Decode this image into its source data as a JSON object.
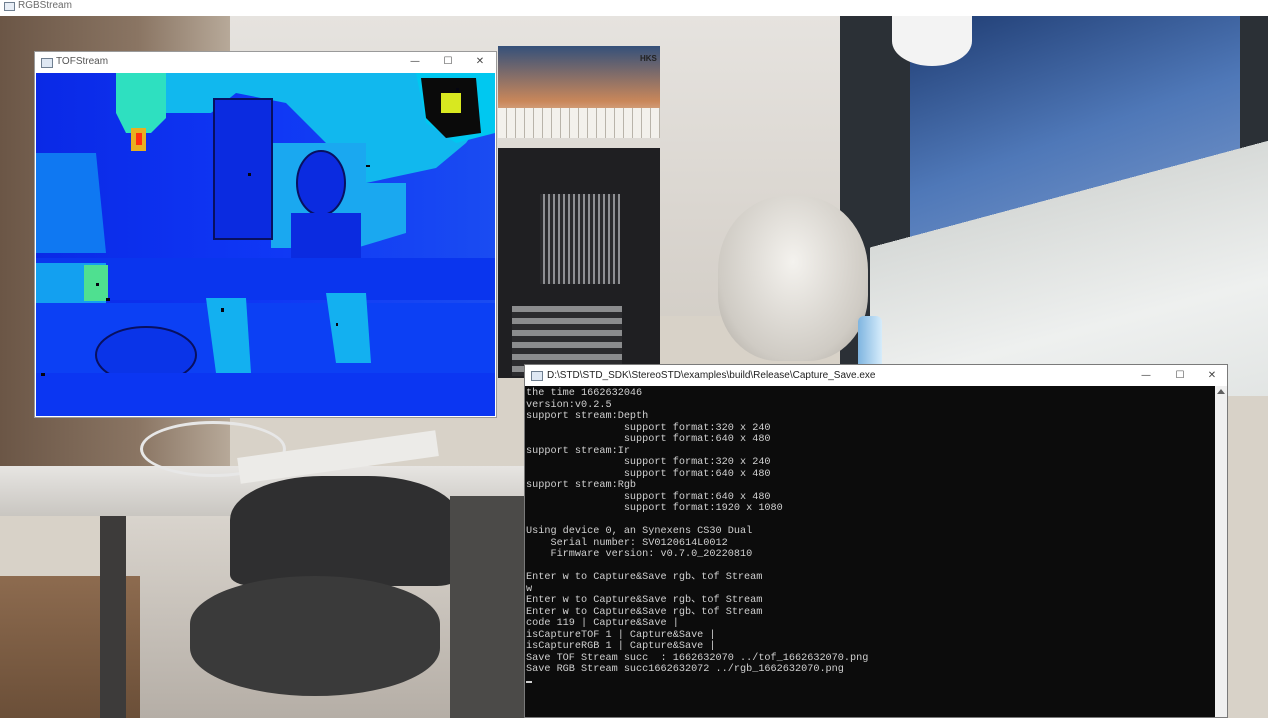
{
  "rgb_window": {
    "title": "RGBStream"
  },
  "tof_window": {
    "title": "TOFStream",
    "min": "—",
    "max": "☐",
    "close": "✕"
  },
  "console_window": {
    "title": "D:\\STD\\STD_SDK\\StereoSTD\\examples\\build\\Release\\Capture_Save.exe",
    "min": "—",
    "max": "☐",
    "close": "✕",
    "lines": [
      "the time 1662632046",
      "version:v0.2.5",
      "support stream:Depth",
      "                support format:320 x 240",
      "                support format:640 x 480",
      "support stream:Ir",
      "                support format:320 x 240",
      "                support format:640 x 480",
      "support stream:Rgb",
      "                support format:640 x 480",
      "                support format:1920 x 1080",
      "",
      "Using device 0, an Synexens CS30 Dual",
      "    Serial number: SV0120614L0012",
      "    Firmware version: v0.7.0_20220810",
      "",
      "Enter w to Capture&Save rgb、tof Stream",
      "w",
      "Enter w to Capture&Save rgb、tof Stream",
      "Enter w to Capture&Save rgb、tof Stream",
      "code 119 | Capture&Save |",
      "isCaptureTOF 1 | Capture&Save |",
      "isCaptureRGB 1 | Capture&Save |",
      "Save TOF Stream succ  : 1662632070 ../tof_1662632070.png",
      "Save RGB Stream succ1662632072 ../rgb_1662632070.png"
    ]
  },
  "calendar_brand": "HKS"
}
